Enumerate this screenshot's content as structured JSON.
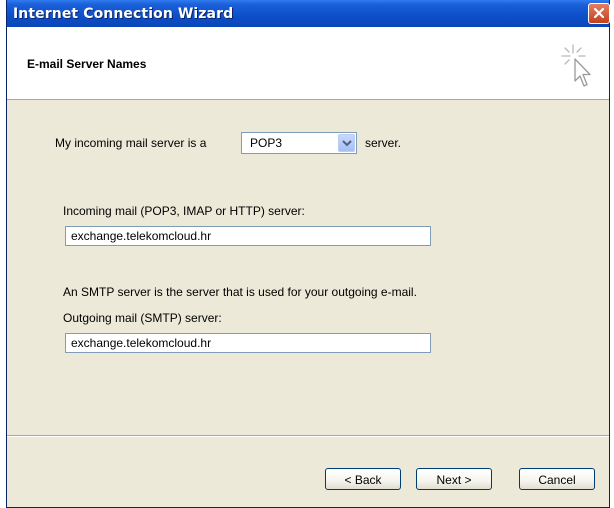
{
  "window": {
    "title": "Internet Connection Wizard",
    "close_icon": "close-icon"
  },
  "header": {
    "title": "E-mail Server Names",
    "icon": "wizard-cursor-icon"
  },
  "form": {
    "server_type_prefix": "My incoming mail server is a",
    "server_type_value": "POP3",
    "server_type_suffix": "server.",
    "incoming_label": "Incoming mail (POP3, IMAP or HTTP) server:",
    "incoming_value": "exchange.telekomcloud.hr",
    "smtp_note": "An SMTP server is the server that is used for your outgoing e-mail.",
    "outgoing_label": "Outgoing mail (SMTP) server:",
    "outgoing_value": "exchange.telekomcloud.hr"
  },
  "buttons": {
    "back": "< Back",
    "next": "Next >",
    "cancel": "Cancel"
  },
  "colors": {
    "titlebar": "#0c4fc9",
    "dialog_bg": "#ece9d8",
    "close_button": "#c3401b"
  }
}
